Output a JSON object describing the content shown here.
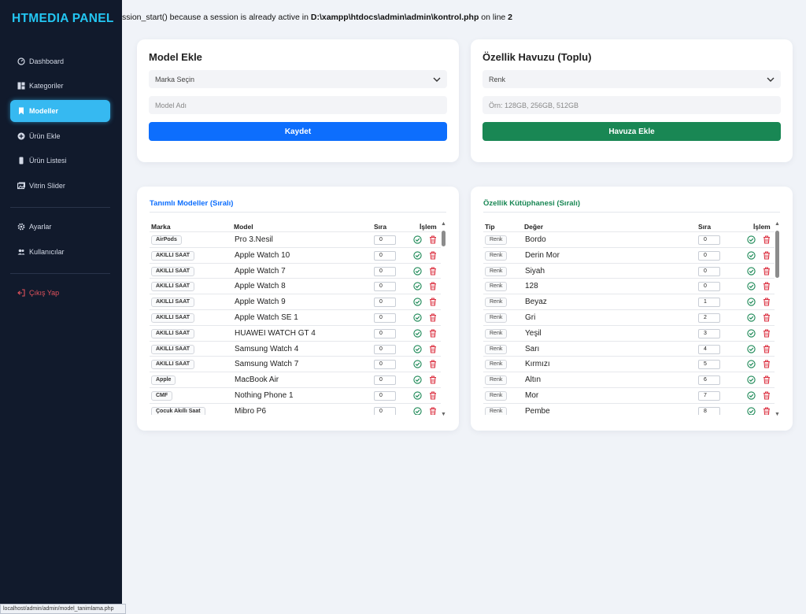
{
  "sidebar": {
    "brand": "HTMEDIA PANEL",
    "items": [
      {
        "label": "Dashboard",
        "icon": "gauge-icon"
      },
      {
        "label": "Kategoriler",
        "icon": "grid-icon"
      },
      {
        "label": "Modeller",
        "icon": "bookmark-icon",
        "active": true
      },
      {
        "label": "Ürün Ekle",
        "icon": "plus-circle-icon"
      },
      {
        "label": "Ürün Listesi",
        "icon": "phone-icon"
      },
      {
        "label": "Vitrin Slider",
        "icon": "images-icon"
      }
    ],
    "items2": [
      {
        "label": "Ayarlar",
        "icon": "gear-icon"
      },
      {
        "label": "Kullanıcılar",
        "icon": "users-icon"
      }
    ],
    "logout": "Çıkış Yap"
  },
  "statusbar": "localhost/admin/admin/model_tanimlama.php",
  "warning": {
    "prefix": "ssion_start() because a session is already active in ",
    "path": "D:\\xampp\\htdocs\\admin\\admin\\kontrol.php",
    "middle": " on line ",
    "line": "2"
  },
  "model_form": {
    "title": "Model Ekle",
    "brand_select": "Marka Seçin",
    "name_placeholder": "Model Adı",
    "submit": "Kaydet"
  },
  "pool_form": {
    "title": "Özellik Havuzu (Toplu)",
    "type_select": "Renk",
    "values_placeholder": "Örn: 128GB, 256GB, 512GB",
    "submit": "Havuza Ekle"
  },
  "models_table": {
    "title": "Tanımlı Modeller (Sıralı)",
    "headers": {
      "brand": "Marka",
      "model": "Model",
      "order": "Sıra",
      "action": "İşlem"
    },
    "rows": [
      {
        "brand": "AirPods",
        "model": "Pro 3.Nesil",
        "order": "0"
      },
      {
        "brand": "AKILLI SAAT",
        "model": "Apple Watch 10",
        "order": "0"
      },
      {
        "brand": "AKILLI SAAT",
        "model": "Apple Watch 7",
        "order": "0"
      },
      {
        "brand": "AKILLI SAAT",
        "model": "Apple Watch 8",
        "order": "0"
      },
      {
        "brand": "AKILLI SAAT",
        "model": "Apple Watch 9",
        "order": "0"
      },
      {
        "brand": "AKILLI SAAT",
        "model": "Apple Watch SE 1",
        "order": "0"
      },
      {
        "brand": "AKILLI SAAT",
        "model": "HUAWEI WATCH GT 4",
        "order": "0"
      },
      {
        "brand": "AKILLI SAAT",
        "model": "Samsung Watch 4",
        "order": "0"
      },
      {
        "brand": "AKILLI SAAT",
        "model": "Samsung Watch 7",
        "order": "0"
      },
      {
        "brand": "Apple",
        "model": "MacBook Air",
        "order": "0"
      },
      {
        "brand": "CMF",
        "model": "Nothing Phone 1",
        "order": "0"
      },
      {
        "brand": "Çocuk Akıllı Saat",
        "model": "Mibro P6",
        "order": "0"
      }
    ]
  },
  "library_table": {
    "title": "Özellik Kütüphanesi (Sıralı)",
    "headers": {
      "type": "Tip",
      "value": "Değer",
      "order": "Sıra",
      "action": "İşlem"
    },
    "rows": [
      {
        "type": "Renk",
        "value": "Bordo",
        "order": "0"
      },
      {
        "type": "Renk",
        "value": "Derin Mor",
        "order": "0"
      },
      {
        "type": "Renk",
        "value": "Siyah",
        "order": "0"
      },
      {
        "type": "Renk",
        "value": "128",
        "order": "0"
      },
      {
        "type": "Renk",
        "value": "Beyaz",
        "order": "1"
      },
      {
        "type": "Renk",
        "value": "Gri",
        "order": "2"
      },
      {
        "type": "Renk",
        "value": "Yeşil",
        "order": "3"
      },
      {
        "type": "Renk",
        "value": "Sarı",
        "order": "4"
      },
      {
        "type": "Renk",
        "value": "Kırmızı",
        "order": "5"
      },
      {
        "type": "Renk",
        "value": "Altın",
        "order": "6"
      },
      {
        "type": "Renk",
        "value": "Mor",
        "order": "7"
      },
      {
        "type": "Renk",
        "value": "Pembe",
        "order": "8"
      }
    ]
  },
  "colors": {
    "brand": "#23c6f2",
    "active": "#36b9f1",
    "primary": "#0d6efd",
    "success": "#198754",
    "danger": "#dc3545",
    "models_title": "#0d6efd",
    "library_title": "#198754"
  }
}
